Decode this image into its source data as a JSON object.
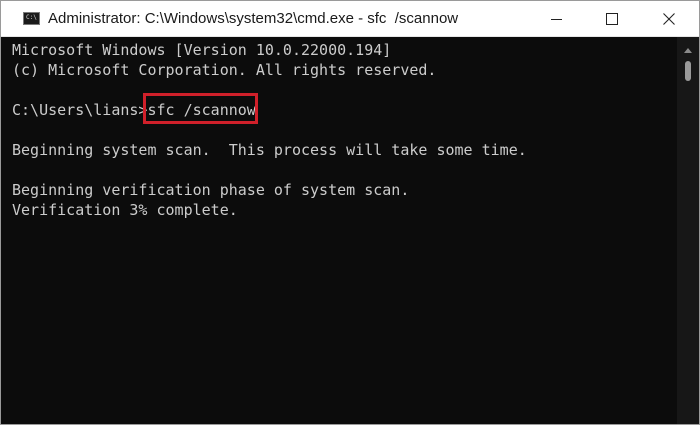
{
  "window": {
    "title": "Administrator: C:\\Windows\\system32\\cmd.exe - sfc  /scannow",
    "app_icon": "cmd-icon",
    "app_icon_glyph": "C:\\"
  },
  "controls": {
    "minimize_icon": "minimize-icon",
    "maximize_icon": "maximize-icon",
    "close_icon": "close-icon"
  },
  "console": {
    "lines": [
      "Microsoft Windows [Version 10.0.22000.194]",
      "(c) Microsoft Corporation. All rights reserved.",
      "C:\\Users\\lians>sfc /scannow",
      "Beginning system scan.  This process will take some time.",
      "Beginning verification phase of system scan.",
      "Verification 3% complete."
    ],
    "highlighted_command": "sfc /scannow",
    "highlight_color": "#d0202a",
    "background_color": "#0c0c0c",
    "text_color": "#cccccc"
  }
}
